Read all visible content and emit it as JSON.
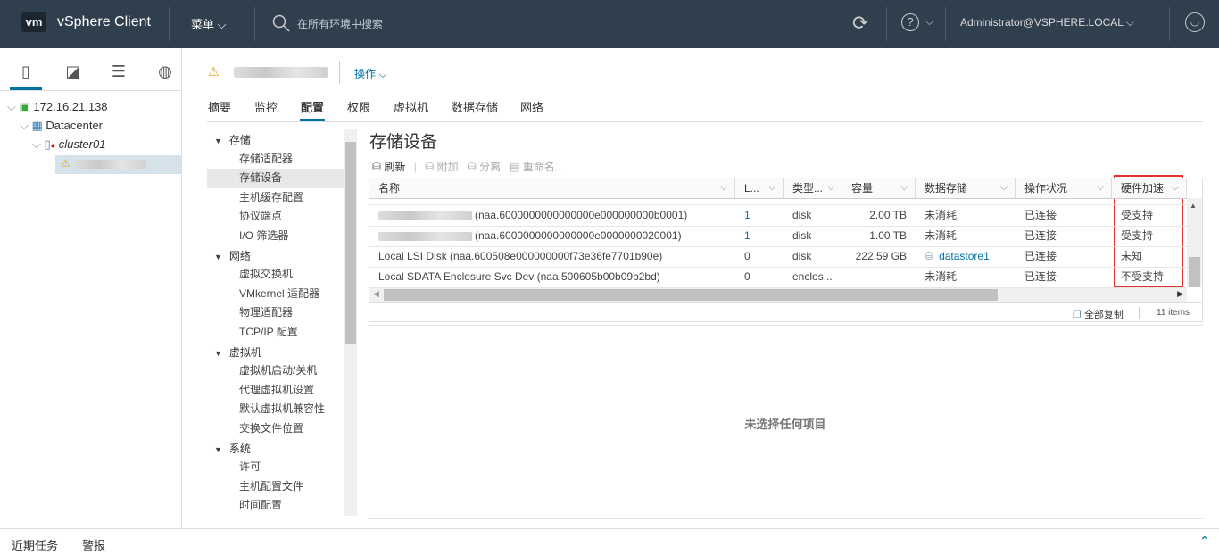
{
  "header": {
    "logo": "vm",
    "app_title": "vSphere Client",
    "menu_label": "菜单",
    "search_placeholder": "在所有环境中搜索",
    "user": "Administrator@VSPHERE.LOCAL"
  },
  "left_tree": [
    {
      "label": "172.16.21.138",
      "icon": "vcenter-icon"
    },
    {
      "label": "Datacenter",
      "icon": "datacenter-icon"
    },
    {
      "label": "cluster01",
      "icon": "cluster-icon"
    },
    {
      "label": "",
      "icon": "host-warning-icon"
    }
  ],
  "object": {
    "actions_label": "操作"
  },
  "tabs": [
    "摘要",
    "监控",
    "配置",
    "权限",
    "虚拟机",
    "数据存储",
    "网络"
  ],
  "active_tab": "配置",
  "config_nav": [
    {
      "group": "存储",
      "items": [
        "存储适配器",
        "存储设备",
        "主机缓存配置",
        "协议端点",
        "I/O 筛选器"
      ]
    },
    {
      "group": "网络",
      "items": [
        "虚拟交换机",
        "VMkernel 适配器",
        "物理适配器",
        "TCP/IP 配置"
      ]
    },
    {
      "group": "虚拟机",
      "items": [
        "虚拟机启动/关机",
        "代理虚拟机设置",
        "默认虚拟机兼容性",
        "交换文件位置"
      ]
    },
    {
      "group": "系统",
      "items": [
        "许可",
        "主机配置文件",
        "时间配置"
      ]
    }
  ],
  "selected_nav": "存储设备",
  "panel": {
    "title": "存储设备",
    "toolbar": {
      "refresh": "刷新",
      "attach": "附加",
      "detach": "分离",
      "rename": "重命名..."
    }
  },
  "table": {
    "columns": [
      "名称",
      "L...",
      "类型...",
      "容量",
      "数据存储",
      "操作状况",
      "硬件加速"
    ],
    "rows": [
      {
        "name": "(naa.6000000000000000e000000000b0001)",
        "lun": "1",
        "type": "disk",
        "capacity": "2.00 TB",
        "datastore": "未消耗",
        "status": "已连接",
        "hw_accel": "受支持"
      },
      {
        "name": "(naa.6000000000000000e0000000020001)",
        "lun": "1",
        "type": "disk",
        "capacity": "1.00 TB",
        "datastore": "未消耗",
        "status": "已连接",
        "hw_accel": "受支持"
      },
      {
        "name": "Local LSI Disk (naa.600508e000000000f73e36fe7701b90e)",
        "lun": "0",
        "type": "disk",
        "capacity": "222.59 GB",
        "datastore": "datastore1",
        "status": "已连接",
        "hw_accel": "未知"
      },
      {
        "name": "Local SDATA Enclosure Svc Dev (naa.500605b00b09b2bd)",
        "lun": "0",
        "type": "enclos...",
        "capacity": "",
        "datastore": "未消耗",
        "status": "已连接",
        "hw_accel": "不受支持"
      }
    ],
    "copy_all": "全部复制",
    "count": "11 items"
  },
  "empty_state": "未选择任何项目",
  "bottom": {
    "recent_tasks": "近期任务",
    "alarms": "警报"
  },
  "colors": {
    "header_bg": "#2f3f4e",
    "accent": "#0072a3",
    "highlight_box": "#e8312f"
  }
}
